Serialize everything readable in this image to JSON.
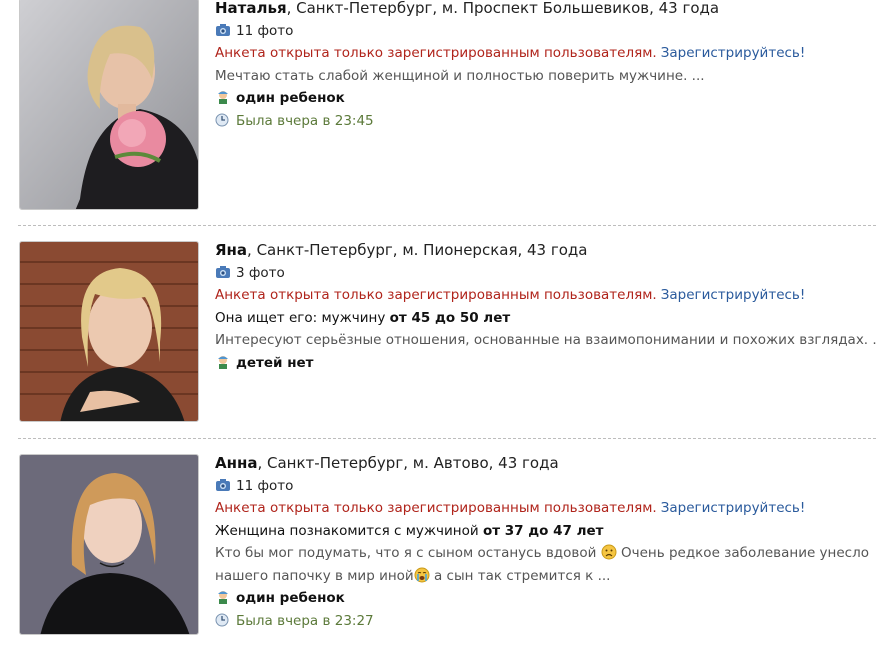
{
  "profiles": [
    {
      "name": "Наталья",
      "location": ", Санкт-Петербург, м. Проспект Большевиков, 43 года",
      "photos": "11 фото",
      "restricted": "Анкета открыта только зарегистрированным пользователям.",
      "register": "Зарегистрируйтесь!",
      "description": "Мечтаю стать слабой женщиной и полностью поверить мужчине. ...",
      "kids": "один ребенок",
      "last_seen": "Была вчера в 23:45"
    },
    {
      "name": "Яна",
      "location": ", Санкт-Петербург, м. Пионерская, 43 года",
      "photos": "3 фото",
      "restricted": "Анкета открыта только зарегистрированным пользователям.",
      "register": "Зарегистрируйтесь!",
      "looking_prefix": "Она ищет его: мужчину ",
      "looking_range": "от 45 до 50 лет",
      "description": "Интересуют серьёзные отношения, основанные на взаимопонимании и похожих взглядах. ...",
      "kids": "детей нет"
    },
    {
      "name": "Анна",
      "location": ", Санкт-Петербург, м. Автово, 43 года",
      "photos": "11 фото",
      "restricted": "Анкета открыта только зарегистрированным пользователям.",
      "register": "Зарегистрируйтесь!",
      "looking_prefix": "Женщина познакомится с мужчиной ",
      "looking_range": "от 37 до 47 лет",
      "description_1": "Кто бы мог подумать, что я с сыном останусь вдовой",
      "description_1b": " Очень редкое заболевание унесло",
      "description_2a": "нашего папочку в мир иной",
      "description_2b": " а сын так стремится к ...",
      "kids": "один ребенок",
      "last_seen": "Была вчера в 23:27"
    }
  ]
}
